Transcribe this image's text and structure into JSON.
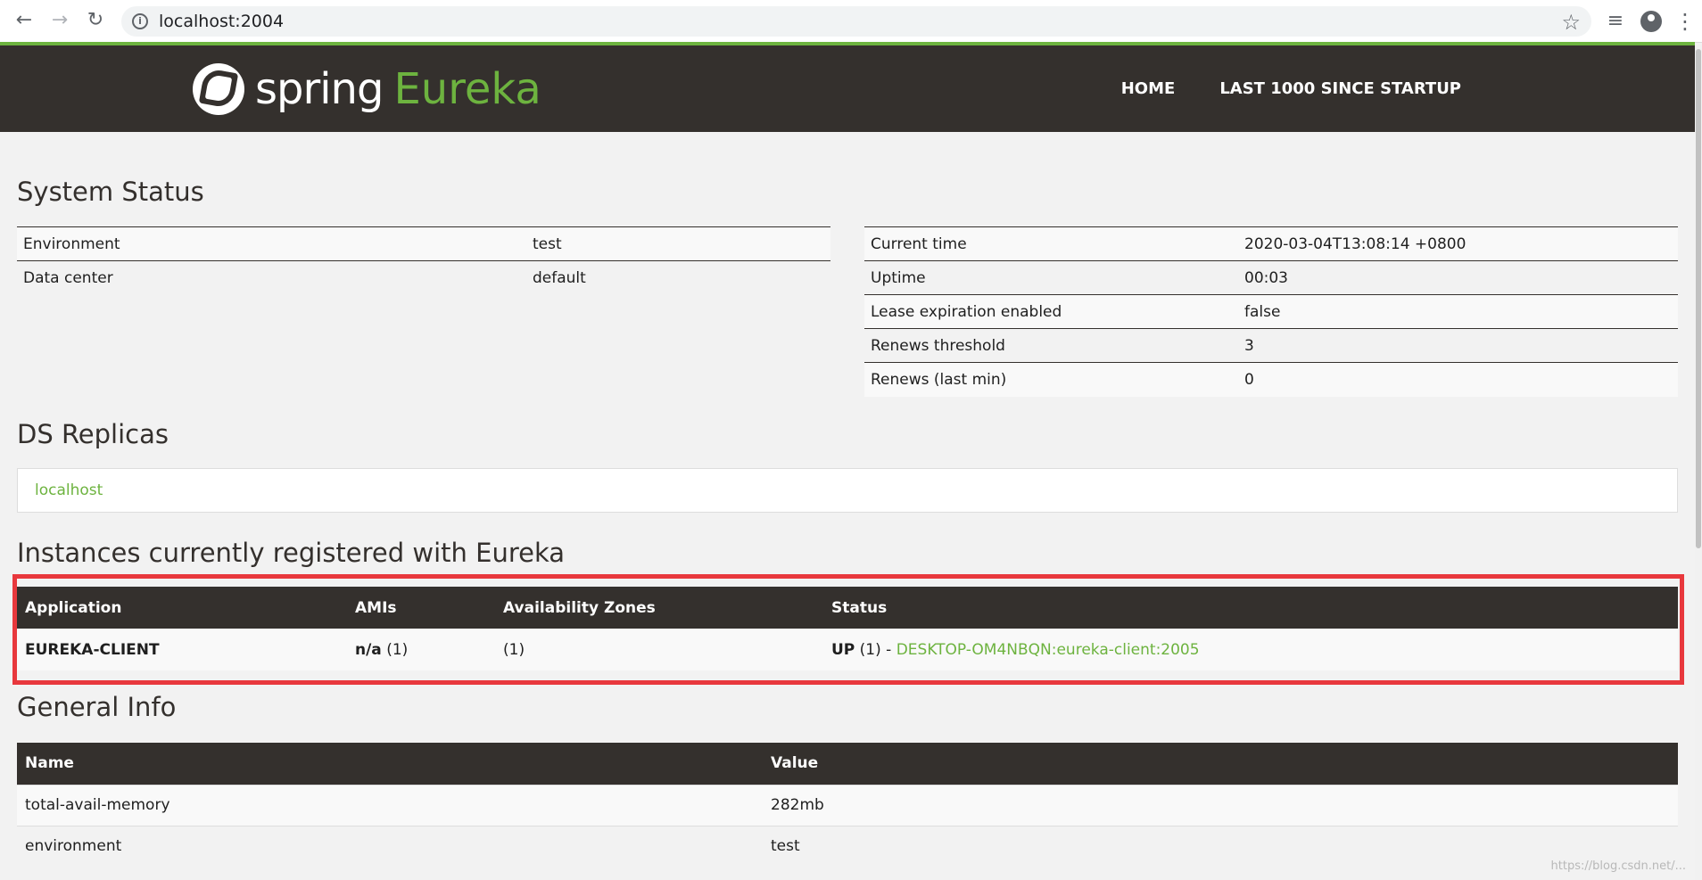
{
  "browser": {
    "url": "localhost:2004",
    "back_icon": "arrow-back-icon",
    "forward_icon": "arrow-forward-icon",
    "reload_icon": "reload-icon"
  },
  "header": {
    "logo_spring": "spring",
    "logo_eureka": "Eureka",
    "nav": [
      "HOME",
      "LAST 1000 SINCE STARTUP"
    ]
  },
  "system_status": {
    "title": "System Status",
    "left": [
      {
        "key": "Environment",
        "value": "test"
      },
      {
        "key": "Data center",
        "value": "default"
      }
    ],
    "right": [
      {
        "key": "Current time",
        "value": "2020-03-04T13:08:14 +0800"
      },
      {
        "key": "Uptime",
        "value": "00:03"
      },
      {
        "key": "Lease expiration enabled",
        "value": "false"
      },
      {
        "key": "Renews threshold",
        "value": "3"
      },
      {
        "key": "Renews (last min)",
        "value": "0"
      }
    ]
  },
  "ds_replicas": {
    "title": "DS Replicas",
    "items": [
      "localhost"
    ]
  },
  "instances": {
    "title": "Instances currently registered with Eureka",
    "columns": [
      "Application",
      "AMIs",
      "Availability Zones",
      "Status"
    ],
    "rows": [
      {
        "application": "EUREKA-CLIENT",
        "amis_bold": "n/a",
        "amis_count": " (1)",
        "zones": "(1)",
        "status_bold": "UP",
        "status_count": " (1) - ",
        "instance_link": "DESKTOP-OM4NBQN:eureka-client:2005"
      }
    ]
  },
  "general_info": {
    "title": "General Info",
    "columns": [
      "Name",
      "Value"
    ],
    "rows": [
      {
        "name": "total-avail-memory",
        "value": "282mb"
      },
      {
        "name": "environment",
        "value": "test"
      }
    ]
  },
  "watermark": "https://blog.csdn.net/..."
}
